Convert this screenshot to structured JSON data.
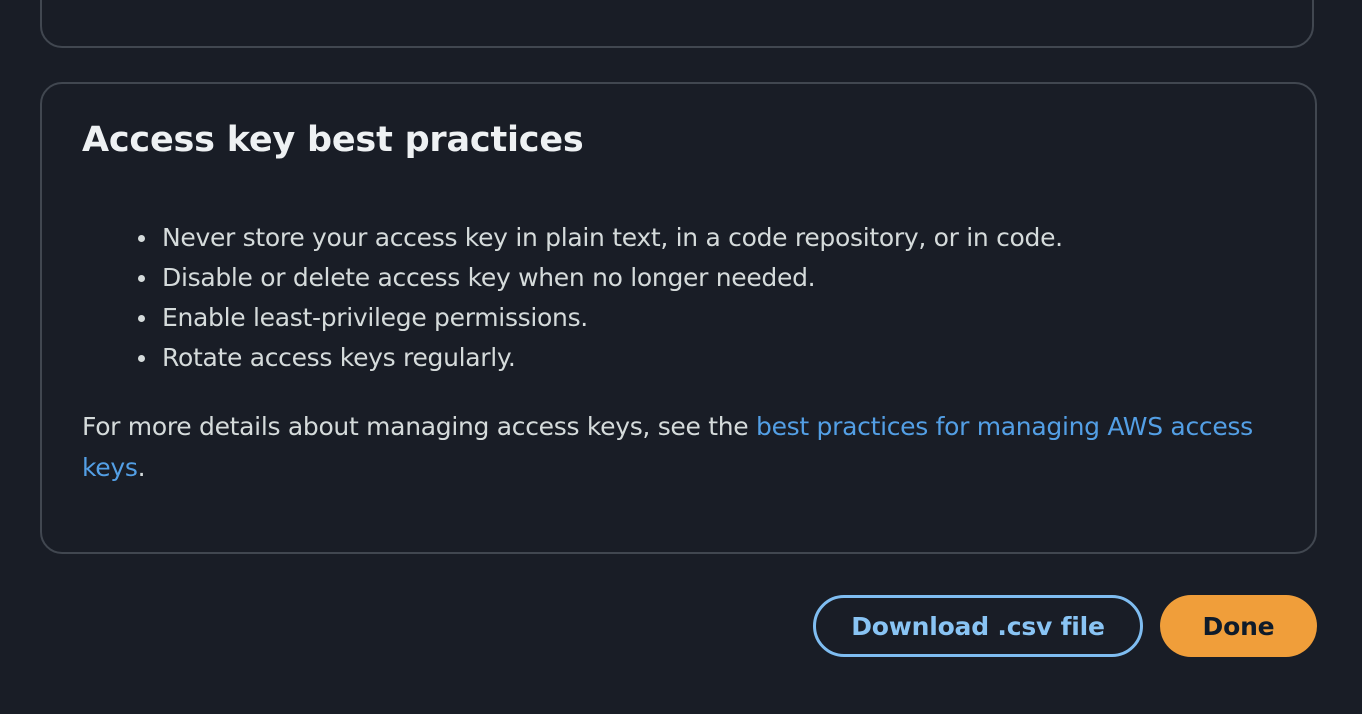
{
  "card": {
    "title": "Access key best practices",
    "bullets": [
      "Never store your access key in plain text, in a code repository, or in code.",
      "Disable or delete access key when no longer needed.",
      "Enable least-privilege permissions.",
      "Rotate access keys regularly."
    ],
    "details_prefix": "For more details about managing access keys, see the ",
    "details_link": "best practices for managing AWS access keys",
    "details_suffix": "."
  },
  "actions": {
    "download_label": "Download .csv file",
    "done_label": "Done"
  },
  "colors": {
    "background": "#191d26",
    "link": "#539fe5",
    "primary_button": "#f09e3a",
    "secondary_button_border": "#7fbdf1"
  }
}
